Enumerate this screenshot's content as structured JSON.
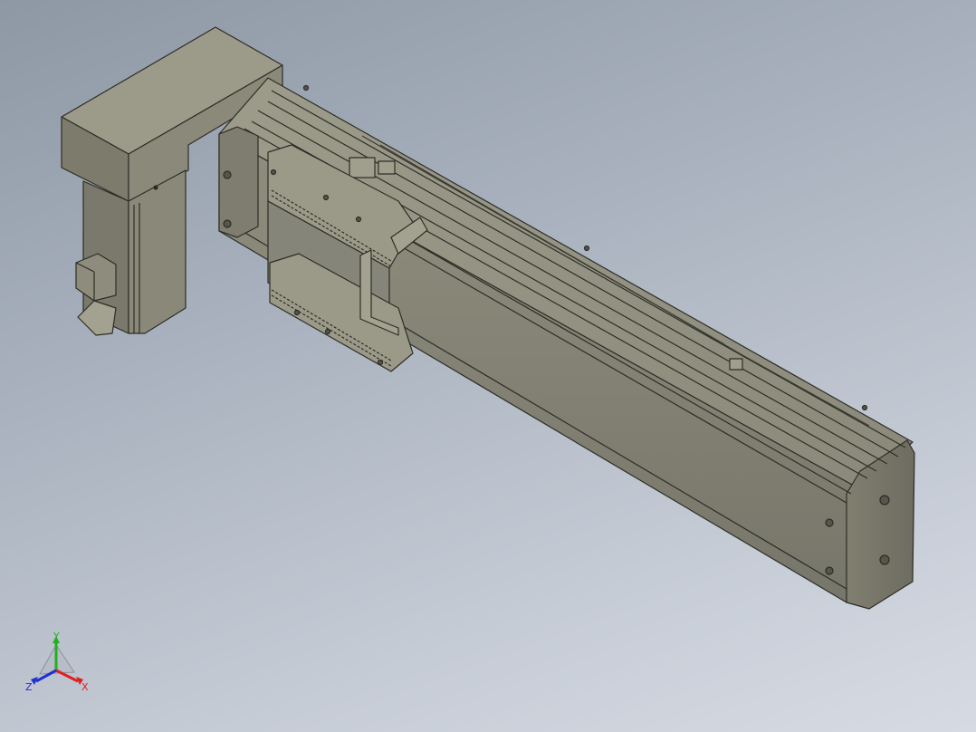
{
  "viewport": {
    "background_top": "#8e98a5",
    "background_bottom": "#d6dbe3",
    "model_color": "#8d8c7c",
    "model_dark": "#5f5e52",
    "model_light": "#a5a493"
  },
  "triad": {
    "x_label": "X",
    "y_label": "Y",
    "z_label": "Z",
    "x_color": "#e02020",
    "y_color": "#20b020",
    "z_color": "#2030d0"
  }
}
